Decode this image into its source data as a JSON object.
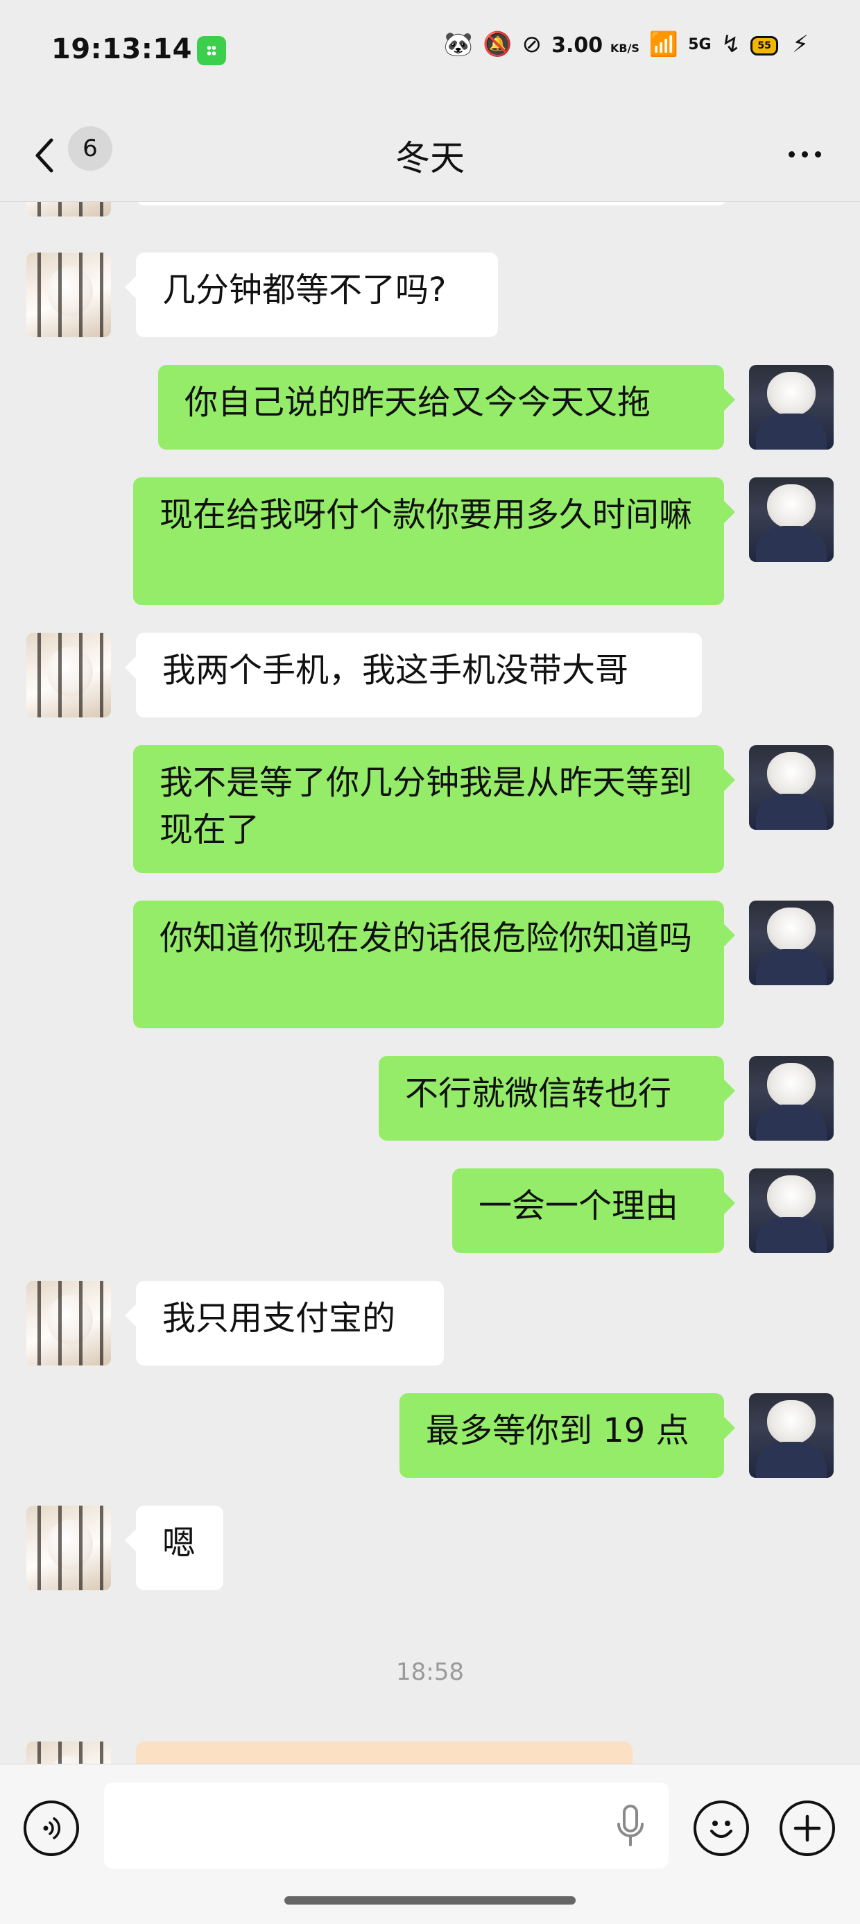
{
  "status_bar": {
    "time": "19:13:14",
    "net_speed_value": "3.00",
    "net_speed_unit": "KB/S",
    "signal_label": "5G",
    "battery_level": "55"
  },
  "header": {
    "unread_count": "6",
    "title": "冬天"
  },
  "messages": [
    {
      "side": "in",
      "text": "几分钟都等不了吗?"
    },
    {
      "side": "out",
      "text": "你自己说的昨天给又今今天又拖"
    },
    {
      "side": "out",
      "text": "现在给我呀付个款你要用多久时间嘛"
    },
    {
      "side": "in",
      "text": "我两个手机，我这手机没带大哥"
    },
    {
      "side": "out",
      "text": "我不是等了你几分钟我是从昨天等到现在了"
    },
    {
      "side": "out",
      "text": "你知道你现在发的话很危险你知道吗"
    },
    {
      "side": "out",
      "text": "不行就微信转也行"
    },
    {
      "side": "out",
      "text": "一会一个理由"
    },
    {
      "side": "in",
      "text": "我只用支付宝的"
    },
    {
      "side": "out",
      "text": "最多等你到 19 点"
    },
    {
      "side": "in",
      "text": "嗯"
    }
  ],
  "timestamp": "18:58",
  "input": {
    "value": "",
    "placeholder": ""
  },
  "icons": {
    "back": "chevron-left-icon",
    "more": "more-dots-icon",
    "voice": "voice-mode-icon",
    "mic": "microphone-icon",
    "emoji": "emoji-icon",
    "plus": "plus-icon"
  },
  "colors": {
    "background": "#ededed",
    "outgoing_bubble": "#95ec69",
    "incoming_bubble": "#ffffff",
    "card_bubble": "#fbe0c3"
  }
}
